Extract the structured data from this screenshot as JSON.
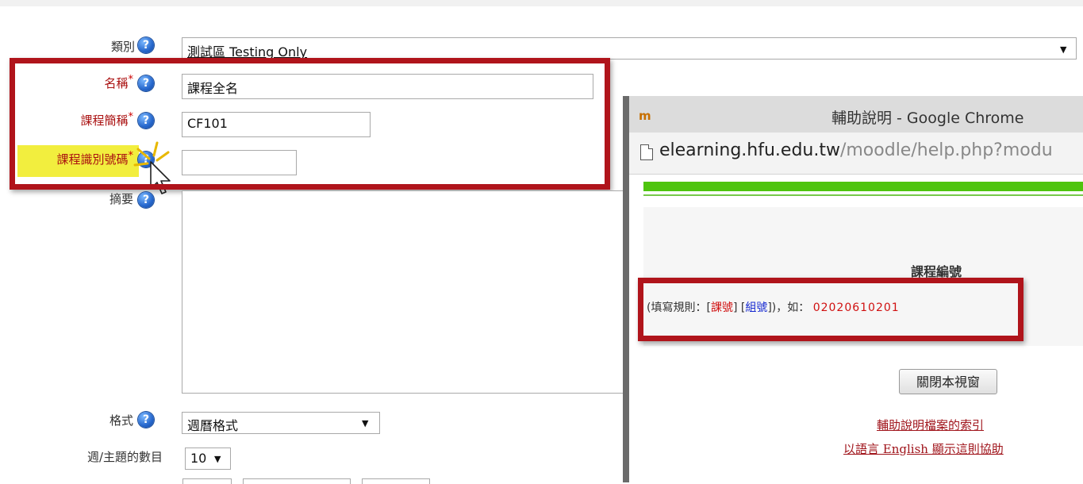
{
  "form": {
    "category": {
      "label": "類別",
      "value": "測試區 Testing Only"
    },
    "fullname": {
      "label": "名稱",
      "value": "課程全名",
      "required": true
    },
    "shortname": {
      "label": "課程簡稱",
      "value": "CF101",
      "required": true
    },
    "idnumber": {
      "label": "課程識別號碼",
      "value": "",
      "required": true
    },
    "summary": {
      "label": "摘要",
      "value": ""
    },
    "format": {
      "label": "格式",
      "value": "週曆格式"
    },
    "numsections": {
      "label": "週/主題的數目",
      "value": "10"
    },
    "required_mark": "*",
    "help_glyph": "?",
    "select_arrow": "▼"
  },
  "popup": {
    "window_title": "輔助說明 - Google Chrome",
    "logo": "m",
    "url_host": "elearning.hfu.edu.tw",
    "url_path": "/moodle/help.php?modu",
    "heading": "課程編號",
    "rule": {
      "prefix": "(填寫規則：[",
      "course_code": "課號",
      "mid": "] [",
      "group_code": "組號",
      "suffix": "])，如：",
      "example": "02020610201"
    },
    "close_button": "關閉本視窗",
    "link_index": "輔助說明檔案的索引",
    "link_language": "以語言 English 顯示這則協助"
  },
  "colors": {
    "annotation_red": "#b0141b",
    "highlight_yellow": "#f2ee3e",
    "help_blue": "#2667cc",
    "green_bar": "#4ec40e"
  },
  "icons": {
    "help": "question-circle-icon",
    "cursor": "mouse-pointer-icon",
    "page": "document-icon"
  }
}
